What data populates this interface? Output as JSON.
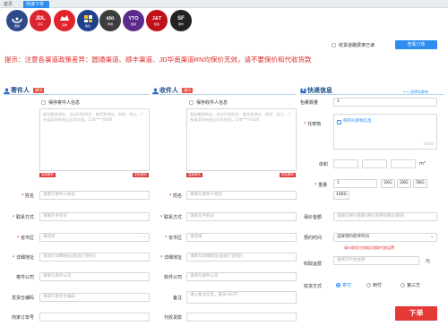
{
  "tabs": [
    {
      "label": "首页"
    },
    {
      "label": "快递下单"
    }
  ],
  "carriers": [
    {
      "name": "",
      "sub": "圆通",
      "bg": "#2f4a8a"
    },
    {
      "name": "JDL",
      "sub": "京东",
      "bg": "#d9232d"
    },
    {
      "name": "JD",
      "sub": "京物",
      "bg": "#e0242c"
    },
    {
      "name": "",
      "sub": "韵达",
      "bg": "#1d3f8c"
    },
    {
      "name": "sto",
      "sub": "申通",
      "bg": "#3d3d3d"
    },
    {
      "name": "YTO",
      "sub": "圆通",
      "bg": "#5a2b8a"
    },
    {
      "name": "J&T",
      "sub": "极兔",
      "bg": "#c0101a"
    },
    {
      "name": "SF",
      "sub": "顺丰",
      "bg": "#222222"
    }
  ],
  "top": {
    "remember_label": "收货道路费率已读",
    "action_btn": "查看订单"
  },
  "notice": "提示：注意各渠道政策差异：圆通渠道、顺丰渠道、JD华南渠道RN均保价无效，请不要保价和代收货款",
  "sender": {
    "title": "寄件人",
    "tag": "通讯",
    "save_label": "保存寄件人信息",
    "paste_hint": "粘贴整段地址，自动识别姓名、电话和地址。例如：张三，广东省深圳市南山区科技园，138****0000",
    "btn_left": "智能解析",
    "btn_right": "粘贴解析",
    "fields": [
      {
        "label": "姓名",
        "star": true,
        "placeholder": "请填写寄件人姓名"
      },
      {
        "label": "联系方式",
        "star": true,
        "placeholder": "请填写手机号"
      },
      {
        "label": "省市区",
        "star": true,
        "placeholder": "请选择"
      },
      {
        "label": "详细地址",
        "star": true,
        "placeholder": "请填写详细地址(街道/门牌号)"
      },
      {
        "label": "寄件公司",
        "star": false,
        "placeholder": "请填写寄件公司"
      },
      {
        "label": "发货仓编码",
        "star": false,
        "placeholder": "请填写发货仓编码"
      },
      {
        "label": "商家订单号",
        "star": false,
        "placeholder": ""
      }
    ]
  },
  "receiver": {
    "title": "收件人",
    "tag": "通讯",
    "save_label": "保存收件人信息",
    "paste_hint": "粘贴整段地址，自动识别姓名、电话和地址。例如：张三，广东省深圳市南山区科技园，138****0000",
    "btn_left": "智能解析",
    "btn_right": "粘贴解析",
    "fields": [
      {
        "label": "姓名",
        "star": true,
        "placeholder": "请填写收件人姓名"
      },
      {
        "label": "联系方式",
        "star": true,
        "placeholder": "请填写手机号"
      },
      {
        "label": "省市区",
        "star": true,
        "placeholder": "请选择"
      },
      {
        "label": "详细地址",
        "star": true,
        "placeholder": "请填写详细地址(街道/门牌号)"
      },
      {
        "label": "收件公司",
        "star": false,
        "placeholder": "请填写收件公司"
      },
      {
        "label": "备注",
        "star": false,
        "placeholder": "填入备注信息，最多100字"
      },
      {
        "label": "代收货款",
        "star": false,
        "placeholder": ""
      }
    ]
  },
  "express": {
    "title": "快递信息",
    "link": "<< 选择包裹单",
    "pkg_label": "包裹数量",
    "pkg_value": "1",
    "item_label": "托寄物",
    "item_check": "保存托寄物信息",
    "count": "0/100",
    "vol_label": "体积",
    "vol_unit": "m³",
    "weight_label": "重量",
    "weight_value": "1",
    "weight_opts": [
      "1KG",
      "2KG",
      "5KG",
      "10KG"
    ],
    "insure_label": "保价金额",
    "insure_placeholder": "请填写保价金额(保价请参照保价规则)",
    "pickup_label": "预约时间",
    "pickup_value": "选择预约取件时间",
    "cod_label": "收取运费",
    "cod_warn": "请与收货方协商后收取代收运费",
    "cod_placeholder": "请填写代收金额",
    "cod_unit": "元",
    "pay_label": "收货方式",
    "pay_opts": [
      "寄付",
      "到付",
      "第三方"
    ]
  },
  "submit_label": "下单"
}
